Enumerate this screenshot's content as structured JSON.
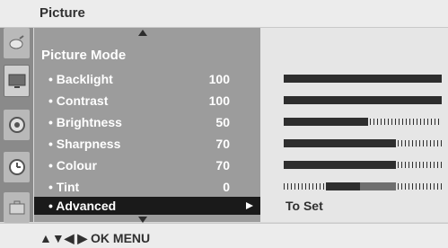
{
  "header": {
    "title": "Picture"
  },
  "menu": {
    "mode_title": "Picture Mode",
    "items": [
      {
        "label": "• Backlight",
        "value": "100",
        "level": 1.0
      },
      {
        "label": "• Contrast",
        "value": "100",
        "level": 1.0
      },
      {
        "label": "• Brightness",
        "value": "50",
        "level": 0.5
      },
      {
        "label": "• Sharpness",
        "value": "70",
        "level": 0.7
      },
      {
        "label": "• Colour",
        "value": "70",
        "level": 0.7
      },
      {
        "label": "• Tint",
        "value": "0",
        "level": 0.5
      }
    ],
    "selected": {
      "label": "• Advanced"
    }
  },
  "right_panel": {
    "to_set": "To Set"
  },
  "footer": {
    "hint": "▲▼◀ ▶ OK  MENU"
  },
  "side_icons": [
    "satellite-dish-icon",
    "tv-screen-icon",
    "speaker-icon",
    "clock-icon",
    "briefcase-icon"
  ],
  "colors": {
    "bar": "#2e2e2e",
    "selection": "#1a1a1a",
    "menu_bg": "#9c9c9c"
  }
}
